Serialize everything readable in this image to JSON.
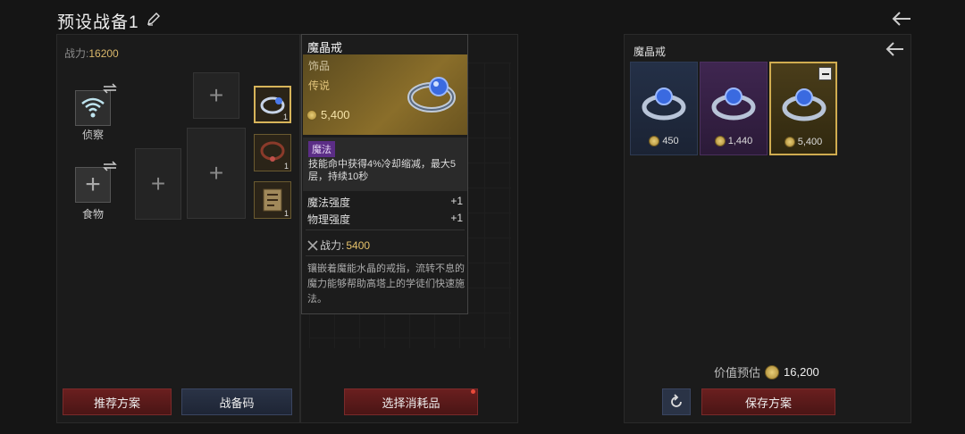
{
  "header": {
    "title": "预设战备1"
  },
  "left": {
    "power_label": "战力:",
    "power_value": "16200",
    "scout_label": "侦察",
    "food_label": "食物",
    "equip_counts": [
      "1",
      "1",
      "1"
    ],
    "recommend_button": "推荐方案",
    "gear_code_button": "战备码"
  },
  "middle": {
    "select_consumable_button": "选择消耗品"
  },
  "tooltip": {
    "name": "魔晶戒",
    "type": "饰品",
    "rarity": "传说",
    "price": "5,400",
    "effect_tag": "魔法",
    "effect_text": "技能命中获得4%冷却缩减，最大5层，持续10秒",
    "stats": [
      {
        "name": "魔法强度",
        "value": "+1"
      },
      {
        "name": "物理强度",
        "value": "+1"
      }
    ],
    "power_label": "战力:",
    "power_value": "5400",
    "description": "镶嵌着魔能水晶的戒指，流转不息的魔力能够帮助高塔上的学徒们快速施法。"
  },
  "right": {
    "title": "魔晶戒",
    "cards": [
      {
        "price": "450",
        "tier": "blue"
      },
      {
        "price": "1,440",
        "tier": "purple"
      },
      {
        "price": "5,400",
        "tier": "gold"
      }
    ],
    "estimate_label": "价值预估",
    "estimate_value": "16,200",
    "save_button": "保存方案"
  },
  "colors": {
    "accent_gold": "#d7b45a",
    "button_red": "#6a1f1f",
    "button_blue": "#2a3346",
    "tag_purple": "#5b2d86"
  }
}
